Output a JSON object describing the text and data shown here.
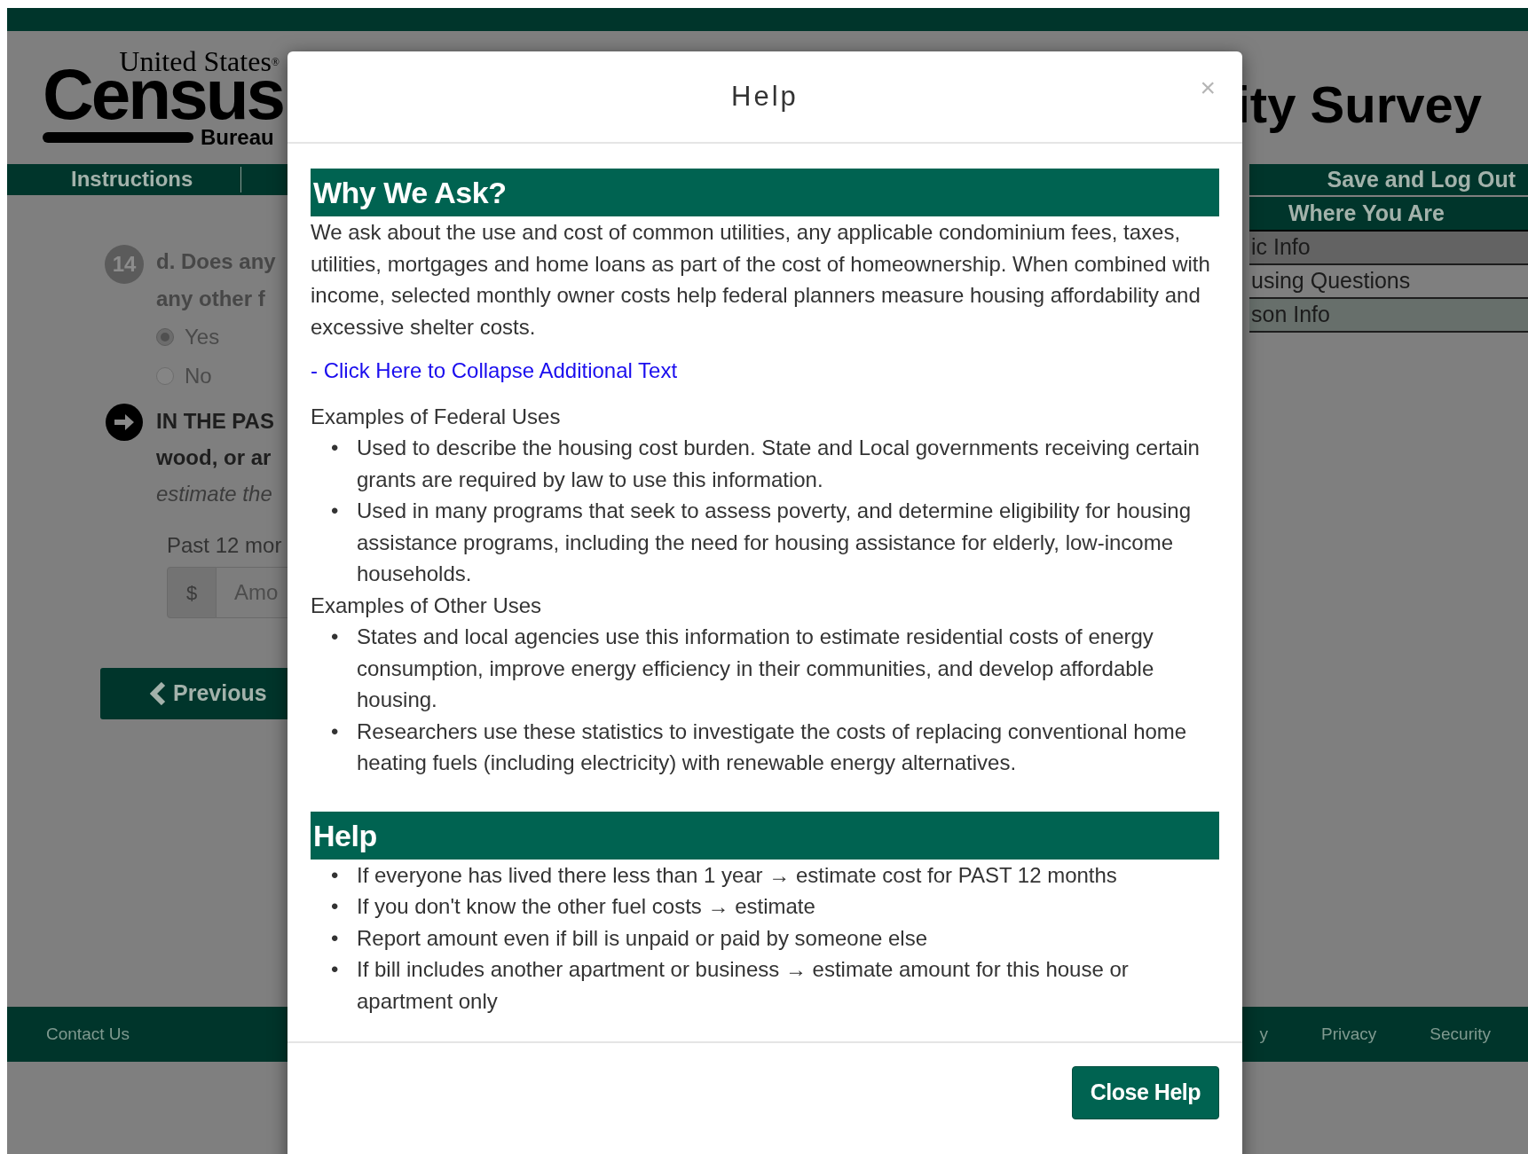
{
  "page": {
    "logo": {
      "top": "United States",
      "mark": "®",
      "main": "Census",
      "bottom": "Bureau"
    },
    "title": "ity Survey",
    "nav": {
      "left": "Instructions",
      "right": "Save and Log Out"
    },
    "question": {
      "number": "14",
      "lines": [
        "d. Does any",
        "any other f"
      ],
      "options": [
        {
          "label": "Yes",
          "selected": true
        },
        {
          "label": "No",
          "selected": false
        }
      ]
    },
    "instruction": {
      "lines": [
        "IN THE PAS",
        "wood, or ar"
      ],
      "note": "estimate the"
    },
    "amount": {
      "label": "Past 12 mor",
      "prefix": "$",
      "placeholder": "Amo"
    },
    "previous": "Previous",
    "sidebar": {
      "title": "Where You Are",
      "items": [
        {
          "label": "ic Info",
          "selected": true
        },
        {
          "label": "using Questions",
          "selected": false
        },
        {
          "label": "son Info",
          "selected": false
        }
      ]
    },
    "footer": {
      "left": "Contact Us",
      "right": [
        "y",
        "Privacy",
        "Security"
      ]
    }
  },
  "modal": {
    "title": "Help",
    "close": "×",
    "bullet": "•",
    "sections": [
      {
        "kind": "detail",
        "heading": "Why We Ask?",
        "text": "We ask about the use and cost of common utilities, any applicable condominium fees, taxes, utilities, mortgages and home loans as part of the cost of homeownership. When combined with income, selected monthly owner costs help federal planners measure housing affordability and excessive shelter costs.",
        "link": "- Click Here to Collapse Additional Text",
        "groups": [
          {
            "title": "Examples of Federal Uses",
            "items": [
              "Used to describe the housing cost burden. State and Local governments receiving certain grants are required by law to use this information.",
              "Used in many programs that seek to assess poverty, and determine eligibility for housing assistance programs, including the need for housing assistance for elderly, low-income households."
            ]
          },
          {
            "title": "Examples of Other Uses",
            "items": [
              "States and local agencies use this information to estimate residential costs of energy consumption, improve energy efficiency in their communities, and develop affordable housing.",
              "Researchers use these statistics to investigate the costs of replacing conventional home heating fuels (including electricity) with renewable energy alternatives."
            ]
          }
        ]
      },
      {
        "kind": "list",
        "heading": "Help",
        "items": [
          "If everyone has lived there less than 1 year → estimate cost for PAST 12 months",
          "If you don't know the other fuel costs → estimate",
          "Report amount even if bill is unpaid or paid by someone else",
          "If bill includes another apartment or business → estimate amount for this house or apartment only"
        ]
      }
    ],
    "button": "Close Help"
  }
}
